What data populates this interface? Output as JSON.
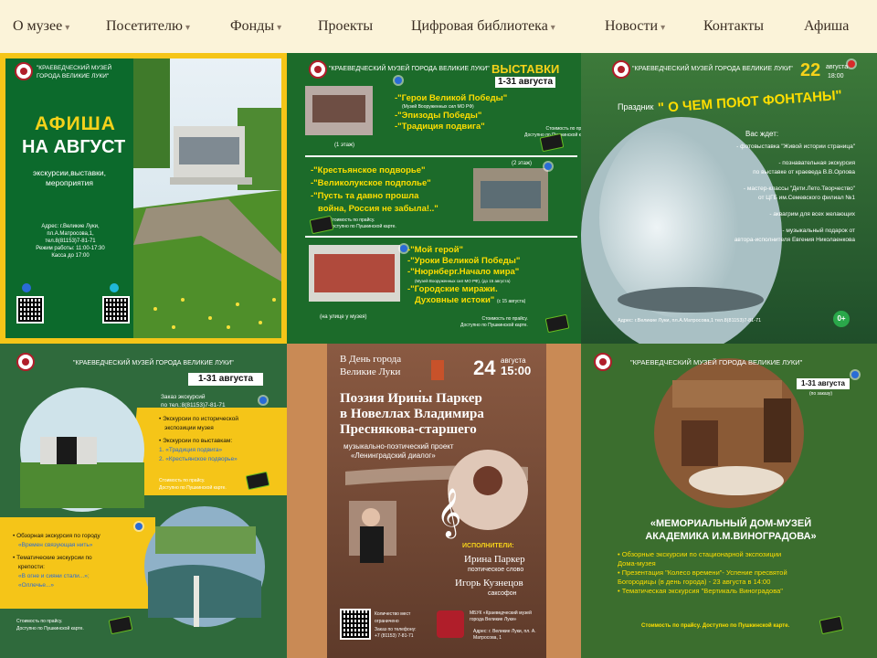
{
  "nav": {
    "items": [
      {
        "label": "О музее",
        "dropdown": true
      },
      {
        "label": "Посетителю",
        "dropdown": true
      },
      {
        "label": "Фонды",
        "dropdown": true
      },
      {
        "label": "Проекты",
        "dropdown": false
      },
      {
        "label": "Цифровая библиотека",
        "dropdown": true
      },
      {
        "label": "Новости",
        "dropdown": true
      },
      {
        "label": "Контакты",
        "dropdown": false
      },
      {
        "label": "Афиша",
        "dropdown": false
      }
    ]
  },
  "card1": {
    "museum": "\"КРАЕВЕДЧЕСКИЙ МУЗЕЙ ГОРОДА ВЕЛИКИЕ ЛУКИ\"",
    "title1": "АФИША",
    "title2": "НА АВГУСТ",
    "subtitle": "экскурсии,выставки, мероприятия",
    "address_lines": [
      "Адрес: г.Великие Луки,",
      "пл.А.Матросова,1,",
      "тел.8(81153)7-81-71",
      "Режим работы: 11:00-17:30",
      "Касса до 17:00"
    ]
  },
  "card2": {
    "museum": "\"КРАЕВЕДЧЕСКИЙ МУЗЕЙ ГОРОДА ВЕЛИКИЕ ЛУКИ\"",
    "heading": "ВЫСТАВКИ",
    "dates": "1-31 августа",
    "floor1": "(1 этаж)",
    "floor2": "(2 этаж)",
    "street": "(на улице у музея)",
    "block1": [
      "-\"Герои Великой Победы\"",
      "-\"Эпизоды Победы\"",
      "-\"Традиция подвига\""
    ],
    "block1_note": "(Музей Вооруженных сил МО РФ)",
    "block2": [
      "-\"Крестьянское подворье\"",
      "-\"Великолукское подполье\"",
      "-\"Пусть та давно прошла",
      "война, Россия не забыла!..\""
    ],
    "block3": [
      "-\"Мой герой\"",
      "-\"Уроки Великой Победы\"",
      "-\"Нюрнберг.Начало мира\"",
      "-\"Городские миражи.",
      "Духовные истоки\""
    ],
    "block3_note1": "(Музей Вооруженных сил МО РФ), (до 15 августа)",
    "block3_note2": "(с 15 августа)",
    "price1": "Стоимость по прайсу.",
    "price2": "Доступно по Пушкинской карте."
  },
  "card3": {
    "museum": "\"КРАЕВЕДЧЕСКИЙ МУЗЕЙ ГОРОДА ВЕЛИКИЕ ЛУКИ\"",
    "date_day": "22",
    "date_month": "августа",
    "date_time": "18:00",
    "prazdnik": "Праздник",
    "title": "\" О ЧЕМ ПОЮТ ФОНТАНЫ\"",
    "waits": "Вас ждет:",
    "lines": [
      "- фотовыставка \"Живой истории страница\"",
      "- познавательная экскурсия",
      "по выставке от краеведа В.В.Орлова",
      "- мастер-классы \"Дети.Лето.Творчество\"",
      "от ЦГБ им.Семевского филиал №1",
      "- аквагрим для всех желающих",
      "- музыкальный подарок от",
      "автора-исполнителя Евгения Николаенкова"
    ],
    "address": "Адрес: г.Великие Луки, пл.А.Матросова,1  тел.8(81153)7-81-71",
    "age": "0+"
  },
  "card4": {
    "museum": "\"КРАЕВЕДЧЕСКИЙ МУЗЕЙ ГОРОДА ВЕЛИКИЕ ЛУКИ\"",
    "dates": "1-31 августа",
    "order1": "Заказ экскурсий",
    "order2": "по тел.:8(81153)7-81-71",
    "lines": [
      "Экскурсии по исторической",
      "экспозиции музея",
      "Экскурсии по выставкам:",
      "1. «Традиция подвига»",
      "2. «Крестьянское подворье»"
    ],
    "price1": "Стоимость по прайсу.",
    "price2": "Доступно по Пушкинской карте.",
    "city_lines": [
      "Обзорная экскурсия по городу",
      "«Времен связующая нить»",
      "Тематические экскурсии по",
      "крепости:",
      "«В огне и сияни стали...»;",
      "«Оллечье...»"
    ],
    "price3": "Стоимость по прайсу.",
    "price4": "Доступно по Пушкинской карте."
  },
  "card5": {
    "day_line1": "В День города",
    "day_line2": "Великие Луки",
    "date_num": "24",
    "date_month": "августа",
    "date_time": "15:00",
    "title_lines": [
      "Поэзия Ирины Паркер",
      "в Новеллах Владимира",
      "Преснякова-старшего"
    ],
    "project1": "музыкально-поэтический проект",
    "project2": "«Ленинградский диалог»",
    "performers": "ИСПОЛНИТЕЛИ:",
    "performer1": "Ирина Паркер",
    "performer1_role": "поэтическое слово",
    "performer2": "Игорь Кузнецов",
    "performer2_role": "саксофон",
    "seats": "Количество мест ограничено",
    "order": "Заказ по телефону: +7 (81153) 7-81-71",
    "org": "МБУК «Краеведческий музей города Великие Луки»",
    "org_addr": "Адрес: г. Великие Луки, пл. А. Матросова, 1"
  },
  "card6": {
    "museum": "\"КРАЕВЕДЧЕСКИЙ МУЗЕЙ ГОРОДА ВЕЛИКИЕ ЛУКИ\"",
    "dates": "1-31 августа",
    "dates_note": "(по заказу)",
    "title1": "«МЕМОРИАЛЬНЫЙ ДОМ-МУЗЕЙ",
    "title2": "АКАДЕМИКА И.М.ВИНОГРАДОВА»",
    "lines": [
      "• Обзорные экскурсии по стационарной экспозиции",
      "  Дома-музея",
      "• Презентация \"Колесо времени\"- Успение пресвятой",
      "  Богородицы (в день города) - 23 августа в 14:00",
      "• Тематическая экскурсия \"Вертикаль Виноградова\""
    ],
    "price": "Стоимость по прайсу. Доступно по Пушкинской карте."
  }
}
